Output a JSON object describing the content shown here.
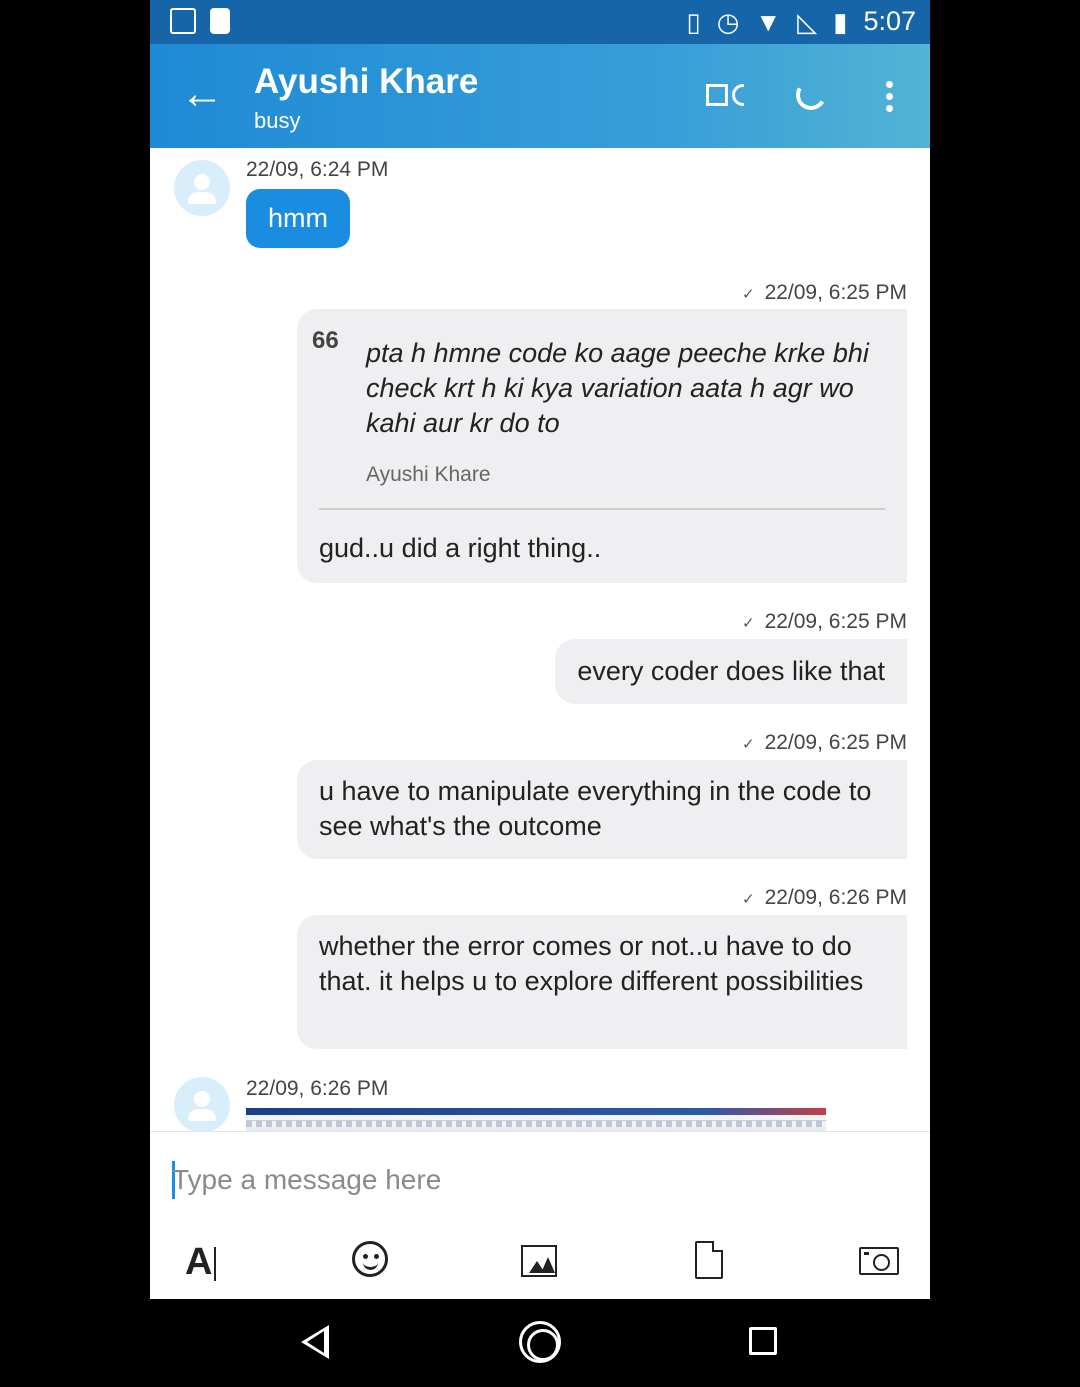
{
  "status_bar": {
    "time": "5:07"
  },
  "header": {
    "back_glyph": "←",
    "contact_name": "Ayushi Khare",
    "contact_status": "busy"
  },
  "messages": [
    {
      "timestamp": "22/09, 6:24 PM",
      "text": "hmm"
    },
    {
      "timestamp": "22/09, 6:25 PM",
      "quote_mark": "66",
      "quote_text": "pta h hmne code ko aage peeche krke bhi check krt h ki kya variation aata h agr wo kahi aur kr do to",
      "quote_author": "Ayushi Khare",
      "text": "gud..u did a right thing.."
    },
    {
      "timestamp": "22/09, 6:25 PM",
      "text": "every coder does like that"
    },
    {
      "timestamp": "22/09, 6:25 PM",
      "text": "u have to manipulate everything in the code to see what's the outcome"
    },
    {
      "timestamp": "22/09, 6:26 PM",
      "text": "whether the error comes or not..u have to do that. it helps u to explore different possibilities"
    },
    {
      "timestamp": "22/09, 6:26 PM"
    }
  ],
  "composer": {
    "placeholder": "Type a message here",
    "value": "",
    "format_glyph": "A"
  },
  "toolbar_icons": [
    "text-format-icon",
    "emoji-icon",
    "image-icon",
    "file-icon",
    "camera-icon"
  ],
  "colors": {
    "appbar_start": "#1e8ad6",
    "appbar_end": "#52b4d4",
    "incoming_bubble": "#1a8de0",
    "outgoing_bubble": "#efeff2"
  }
}
